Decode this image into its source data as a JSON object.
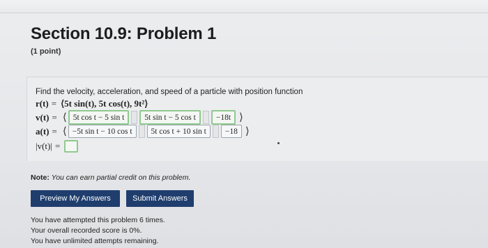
{
  "header": {
    "title": "Section 10.9: Problem 1",
    "points": "(1 point)"
  },
  "problem": {
    "prompt": "Find the velocity, acceleration, and speed of a particle with position function",
    "position": {
      "label": "r(t)",
      "expr": "⟨5t sin(t), 5t cos(t), 9t²⟩"
    },
    "velocity": {
      "label": "v(t)",
      "answers": [
        "5t cos t − 5 sin t",
        "5t sin t − 5 cos t",
        "−18t"
      ]
    },
    "acceleration": {
      "label": "a(t)",
      "answers": [
        "−5t sin t − 10 cos t",
        "5t cos t + 10 sin t",
        "−18"
      ]
    },
    "speed": {
      "label": "|v(t)|",
      "value": ""
    }
  },
  "note": {
    "bold": "Note:",
    "text": "You can earn partial credit on this problem."
  },
  "buttons": {
    "preview": "Preview My Answers",
    "submit": "Submit Answers"
  },
  "status": [
    "You have attempted this problem 6 times.",
    "Your overall recorded score is 0%.",
    "You have unlimited attempts remaining."
  ]
}
